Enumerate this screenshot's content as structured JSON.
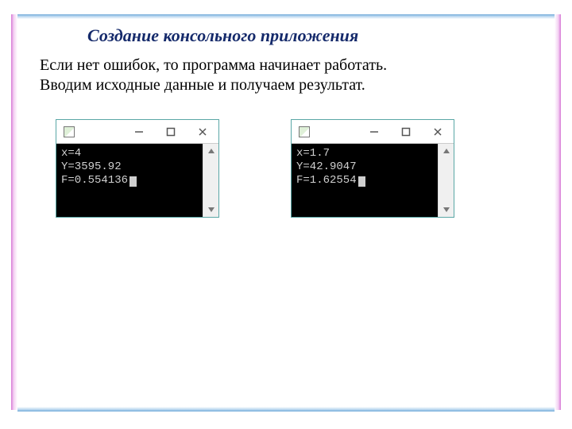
{
  "title": "Создание консольного приложения",
  "paragraph_line1": "Если нет ошибок, то программа начинает работать.",
  "paragraph_line2": "Вводим исходные данные и получаем результат.",
  "consoles": [
    {
      "line1": "x=4",
      "line2": "Y=3595.92",
      "line3": "F=0.554136"
    },
    {
      "line1": "x=1.7",
      "line2": "Y=42.9047",
      "line3": "F=1.62554"
    }
  ]
}
